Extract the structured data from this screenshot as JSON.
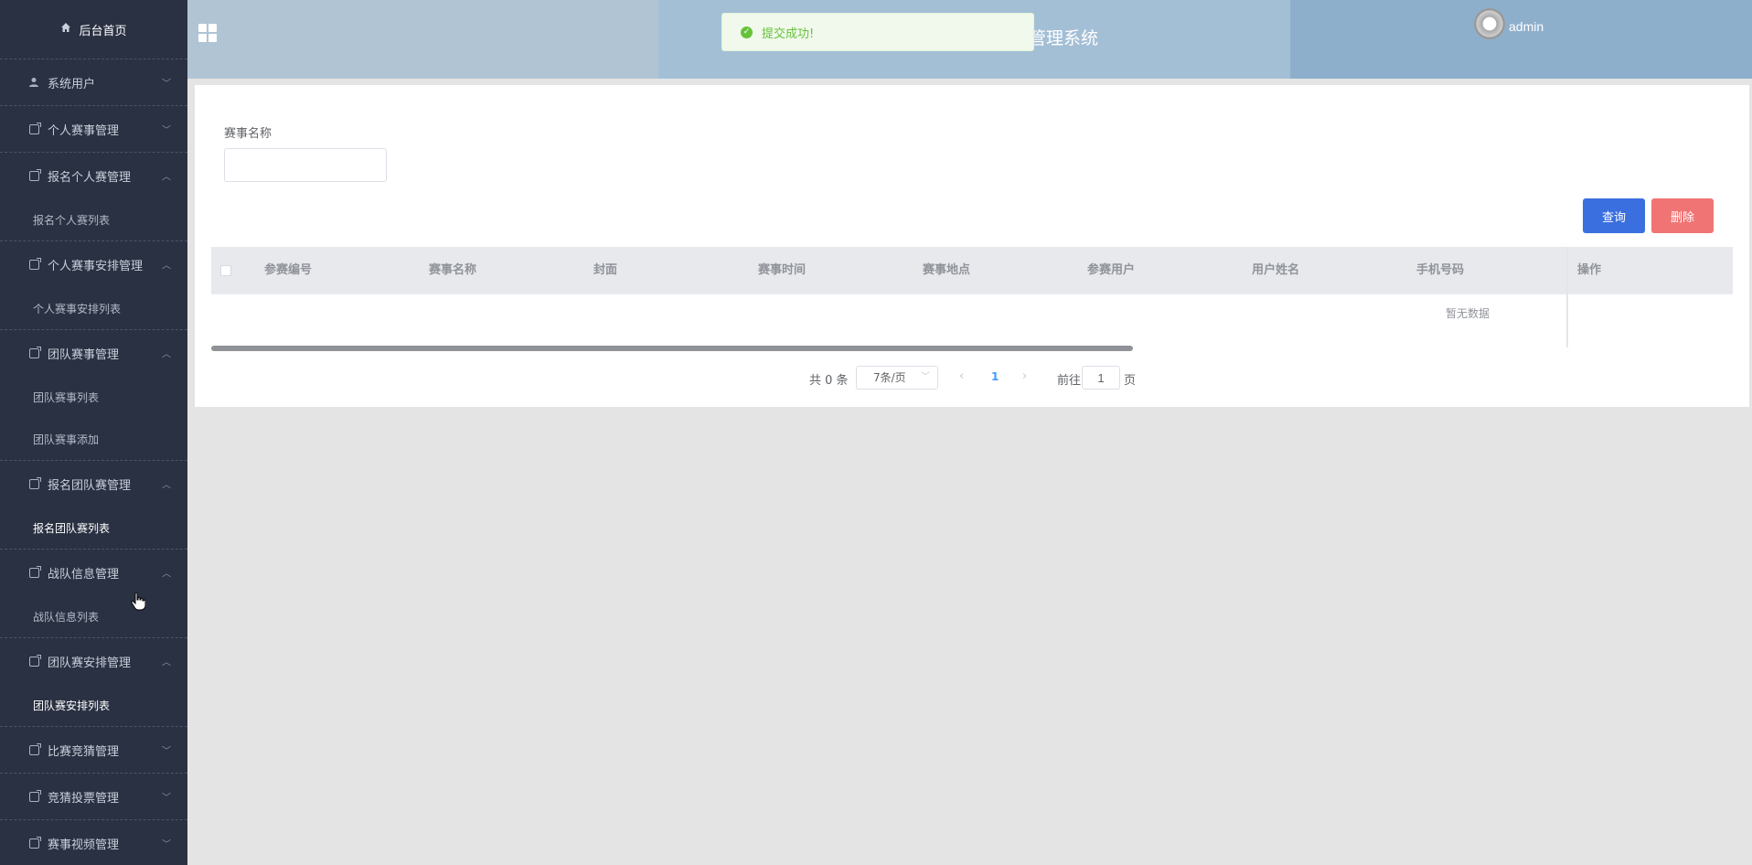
{
  "sidebar": {
    "home_label": "后台首页",
    "groups": [
      {
        "label": "系统用户",
        "chev": "﹀",
        "subs": []
      },
      {
        "label": "个人赛事管理",
        "chev": "﹀",
        "subs": []
      },
      {
        "label": "报名个人赛管理",
        "chev": "︿",
        "subs": [
          "报名个人赛列表"
        ]
      },
      {
        "label": "个人赛事安排管理",
        "chev": "︿",
        "subs": [
          "个人赛事安排列表"
        ]
      },
      {
        "label": "团队赛事管理",
        "chev": "︿",
        "subs": [
          "团队赛事列表",
          "团队赛事添加"
        ]
      },
      {
        "label": "报名团队赛管理",
        "chev": "︿",
        "subs": [
          "报名团队赛列表"
        ]
      },
      {
        "label": "战队信息管理",
        "chev": "︿",
        "subs": [
          "战队信息列表"
        ]
      },
      {
        "label": "团队赛安排管理",
        "chev": "︿",
        "subs": [
          "团队赛安排列表"
        ]
      },
      {
        "label": "比赛竞猜管理",
        "chev": "﹀",
        "subs": []
      },
      {
        "label": "竞猜投票管理",
        "chev": "﹀",
        "subs": []
      },
      {
        "label": "赛事视频管理",
        "chev": "﹀",
        "subs": []
      }
    ]
  },
  "header": {
    "title_fragment": "管理系统",
    "username": "admin"
  },
  "toast": {
    "message": "提交成功!"
  },
  "search": {
    "label": "赛事名称",
    "value": ""
  },
  "buttons": {
    "query": "查询",
    "delete": "删除"
  },
  "table": {
    "columns": [
      "参赛编号",
      "赛事名称",
      "封面",
      "赛事时间",
      "赛事地点",
      "参赛用户",
      "用户姓名",
      "手机号码",
      "操作"
    ],
    "empty_text": "暂无数据"
  },
  "pagination": {
    "total": "共 0 条",
    "page_size": "7条/页",
    "current_page": "1",
    "goto_label": "前往",
    "goto_value": "1",
    "page_suffix": "页"
  },
  "icons": {
    "home": "home-icon",
    "user": "user-icon",
    "doc": "document-icon",
    "grid": "grid-menu-icon",
    "success": "check-circle-icon"
  },
  "colors": {
    "sidebar_bg": "#2a3142",
    "query_button": "#3a6fe0",
    "delete_button": "#f07474",
    "toast_text": "#67c23a"
  }
}
